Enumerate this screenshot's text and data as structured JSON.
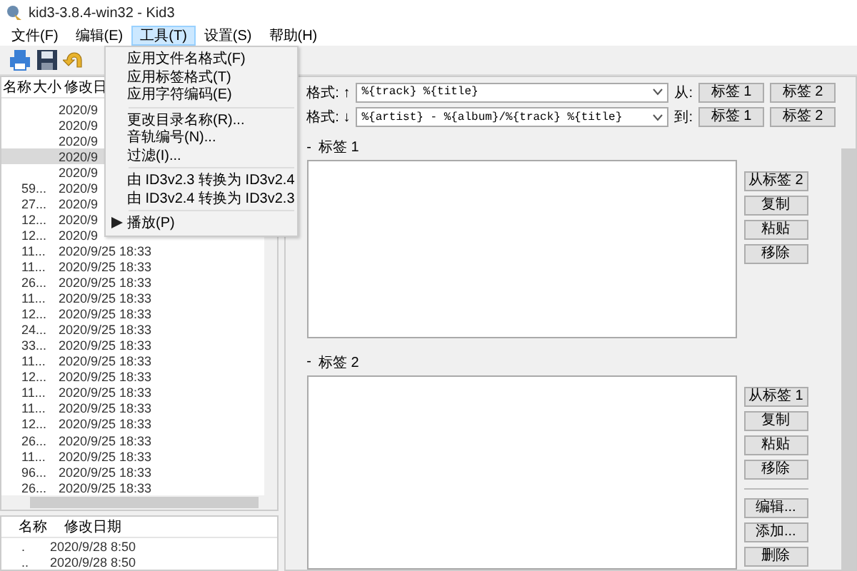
{
  "window": {
    "title": "kid3-3.8.4-win32 - Kid3"
  },
  "menu_bar": [
    {
      "label": "文件(F)",
      "selected": false
    },
    {
      "label": "编辑(E)",
      "selected": false
    },
    {
      "label": "工具(T)",
      "selected": true
    },
    {
      "label": "设置(S)",
      "selected": false
    },
    {
      "label": "帮助(H)",
      "selected": false
    }
  ],
  "file_list": {
    "columns": [
      "名称",
      "大小",
      "修改日"
    ],
    "rows": [
      {
        "date": "2020/9",
        "selected": false
      },
      {
        "date": "2020/9",
        "selected": false
      },
      {
        "date": "2020/9",
        "selected": false
      },
      {
        "date": "2020/9",
        "selected": true
      },
      {
        "date": "2020/9",
        "selected": false
      },
      {
        "size": "59...",
        "date": "2020/9",
        "selected": false
      },
      {
        "size": "27...",
        "date": "2020/9",
        "selected": false
      },
      {
        "size": "12...",
        "date": "2020/9",
        "selected": false
      },
      {
        "size": "12...",
        "date": "2020/9",
        "selected": false
      },
      {
        "size": "11...",
        "date": "2020/9/25 18:33",
        "selected": false
      },
      {
        "size": "11...",
        "date": "2020/9/25 18:33",
        "selected": false
      },
      {
        "size": "26...",
        "date": "2020/9/25 18:33",
        "selected": false
      },
      {
        "size": "11...",
        "date": "2020/9/25 18:33",
        "selected": false
      },
      {
        "size": "12...",
        "date": "2020/9/25 18:33",
        "selected": false
      },
      {
        "size": "24...",
        "date": "2020/9/25 18:33",
        "selected": false
      },
      {
        "size": "33...",
        "date": "2020/9/25 18:33",
        "selected": false
      },
      {
        "size": "11...",
        "date": "2020/9/25 18:33",
        "selected": false
      },
      {
        "size": "12...",
        "date": "2020/9/25 18:33",
        "selected": false
      },
      {
        "size": "11...",
        "date": "2020/9/25 18:33",
        "selected": false
      },
      {
        "size": "11...",
        "date": "2020/9/25 18:33",
        "selected": false
      },
      {
        "size": "12...",
        "date": "2020/9/25 18:33",
        "selected": false
      },
      {
        "size": "26...",
        "date": "2020/9/25 18:33",
        "selected": false
      },
      {
        "size": "11...",
        "date": "2020/9/25 18:33",
        "selected": false
      },
      {
        "size": "96...",
        "date": "2020/9/25 18:33",
        "selected": false
      },
      {
        "size": "26...",
        "date": "2020/9/25 18:33",
        "selected": false
      }
    ]
  },
  "dir_list": {
    "columns": [
      "名称",
      "修改日期"
    ],
    "rows": [
      {
        "name": ".",
        "date": "2020/9/28 8:50"
      },
      {
        "name": "..",
        "date": "2020/9/28 8:50"
      }
    ]
  },
  "format_rows": [
    {
      "label": "格式:",
      "arrow": "↑",
      "value": "%{track} %{title}",
      "target_label": "从:",
      "buttons": [
        "标签 1",
        "标签 2"
      ]
    },
    {
      "label": "格式:",
      "arrow": "↓",
      "value": "%{artist} - %{album}/%{track} %{title}",
      "target_label": "到:",
      "buttons": [
        "标签 1",
        "标签 2"
      ]
    }
  ],
  "tags": [
    {
      "toggle": "-",
      "title": "标签 1",
      "buttons": [
        "从标签 2",
        "复制",
        "粘贴",
        "移除"
      ]
    },
    {
      "toggle": "-",
      "title": "标签 2",
      "buttons": [
        "从标签 1",
        "复制",
        "粘贴",
        "移除"
      ],
      "extra_buttons": [
        "编辑...",
        "添加...",
        "删除"
      ]
    }
  ],
  "tools_menu": {
    "items": [
      {
        "kind": "item",
        "label": "应用文件名格式(F)"
      },
      {
        "kind": "item",
        "label": "应用标签格式(T)"
      },
      {
        "kind": "item",
        "label": "应用字符编码(E)"
      },
      {
        "kind": "separator"
      },
      {
        "kind": "item",
        "label": "更改目录名称(R)..."
      },
      {
        "kind": "item",
        "label": "音轨编号(N)..."
      },
      {
        "kind": "item",
        "label": "过滤(I)..."
      },
      {
        "kind": "separator"
      },
      {
        "kind": "item",
        "label": "由 ID3v2.3 转换为 ID3v2.4"
      },
      {
        "kind": "item",
        "label": "由 ID3v2.4 转换为 ID3v2.3"
      },
      {
        "kind": "separator"
      },
      {
        "kind": "play",
        "label": "播放(P)"
      }
    ]
  }
}
